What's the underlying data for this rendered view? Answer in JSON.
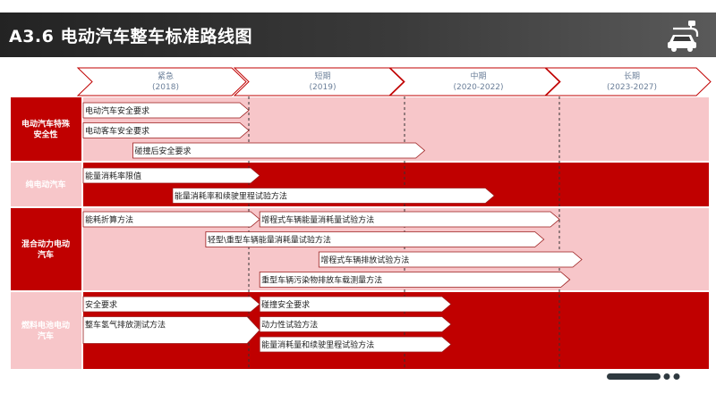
{
  "title": "A3.6  电动汽车整车标准路线图",
  "colors": {
    "accent": "#c00000",
    "lane_light": "#f7c6c9",
    "arrow_border": "#9a1a1a"
  },
  "icons": [
    "electric-car-icon"
  ],
  "phases": [
    {
      "name": "紧急",
      "period": "(2018)"
    },
    {
      "name": "短期",
      "period": "(2019)"
    },
    {
      "name": "中期",
      "period": "(2020-2022)"
    },
    {
      "name": "长期",
      "period": "(2023-2027)"
    }
  ],
  "lanes": [
    {
      "label": [
        "电动汽车特殊",
        "安全性"
      ],
      "bg": "light"
    },
    {
      "label": [
        "纯电动汽车"
      ],
      "bg": "red"
    },
    {
      "label": [
        "混合动力电动",
        "汽车"
      ],
      "bg": "light"
    },
    {
      "label": [
        "燃料电池电动",
        "汽车"
      ],
      "bg": "red"
    }
  ],
  "items": [
    {
      "lane": 0,
      "text": "电动汽车安全要求",
      "start": 0,
      "end": 1.0,
      "row": 0
    },
    {
      "lane": 0,
      "text": "电动客车安全要求",
      "start": 0,
      "end": 1.0,
      "row": 1
    },
    {
      "lane": 0,
      "text": "碰撞后安全要求",
      "start": 0.3,
      "end": 2.13,
      "row": 2
    },
    {
      "lane": 1,
      "text": "能量消耗率限值",
      "start": 0,
      "end": 1.07,
      "row": 0
    },
    {
      "lane": 1,
      "text": "能量消耗率和续驶里程试验方法",
      "start": 0.54,
      "end": 2.58,
      "row": 1
    },
    {
      "lane": 2,
      "text": "能耗折算方法",
      "start": 0,
      "end": 1.07,
      "row": 0
    },
    {
      "lane": 2,
      "text": "增程式车辆能量消耗量试验方法",
      "start": 1.07,
      "end": 3.0,
      "row": 0
    },
    {
      "lane": 2,
      "text": "轻型\\重型车辆能量消耗量试验方法",
      "start": 0.74,
      "end": 2.9,
      "row": 1
    },
    {
      "lane": 2,
      "text": "增程式车辆排放试验方法",
      "start": 1.45,
      "end": 3.15,
      "row": 2
    },
    {
      "lane": 2,
      "text": "重型车辆污染物排放车载测量方法",
      "start": 1.07,
      "end": 3.07,
      "row": 3
    },
    {
      "lane": 3,
      "text": "安全要求",
      "start": 0,
      "end": 1.07,
      "row": 0
    },
    {
      "lane": 3,
      "text": "整车氢气排放测试方法",
      "start": 0,
      "end": 1.07,
      "row": 1,
      "tall": true
    },
    {
      "lane": 3,
      "text": "碰撞安全要求",
      "start": 1.07,
      "end": 2.3,
      "row": 0
    },
    {
      "lane": 3,
      "text": "动力性试验方法",
      "start": 1.07,
      "end": 2.3,
      "row": 1
    },
    {
      "lane": 3,
      "text": "能量消耗量和续驶里程试验方法",
      "start": 1.07,
      "end": 2.3,
      "row": 2
    }
  ]
}
